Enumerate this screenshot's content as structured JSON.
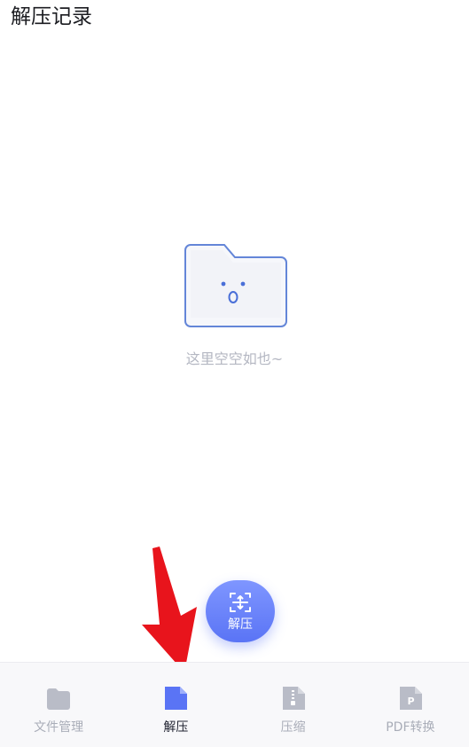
{
  "header": {
    "title": "解压记录"
  },
  "empty_state": {
    "icon": "empty-folder-icon",
    "message": "这里空空如也~"
  },
  "fab": {
    "icon": "decompress-icon",
    "label": "解压"
  },
  "tabbar": {
    "active_index": 1,
    "tabs": [
      {
        "label": "文件管理",
        "icon": "folder-icon"
      },
      {
        "label": "解压",
        "icon": "document-icon"
      },
      {
        "label": "压缩",
        "icon": "zip-file-icon"
      },
      {
        "label": "PDF转换",
        "icon": "pdf-file-icon"
      }
    ]
  },
  "colors": {
    "accent": "#5a74f5",
    "inactive_icon": "#b9bcc7",
    "annotation_arrow": "#e8141c"
  }
}
